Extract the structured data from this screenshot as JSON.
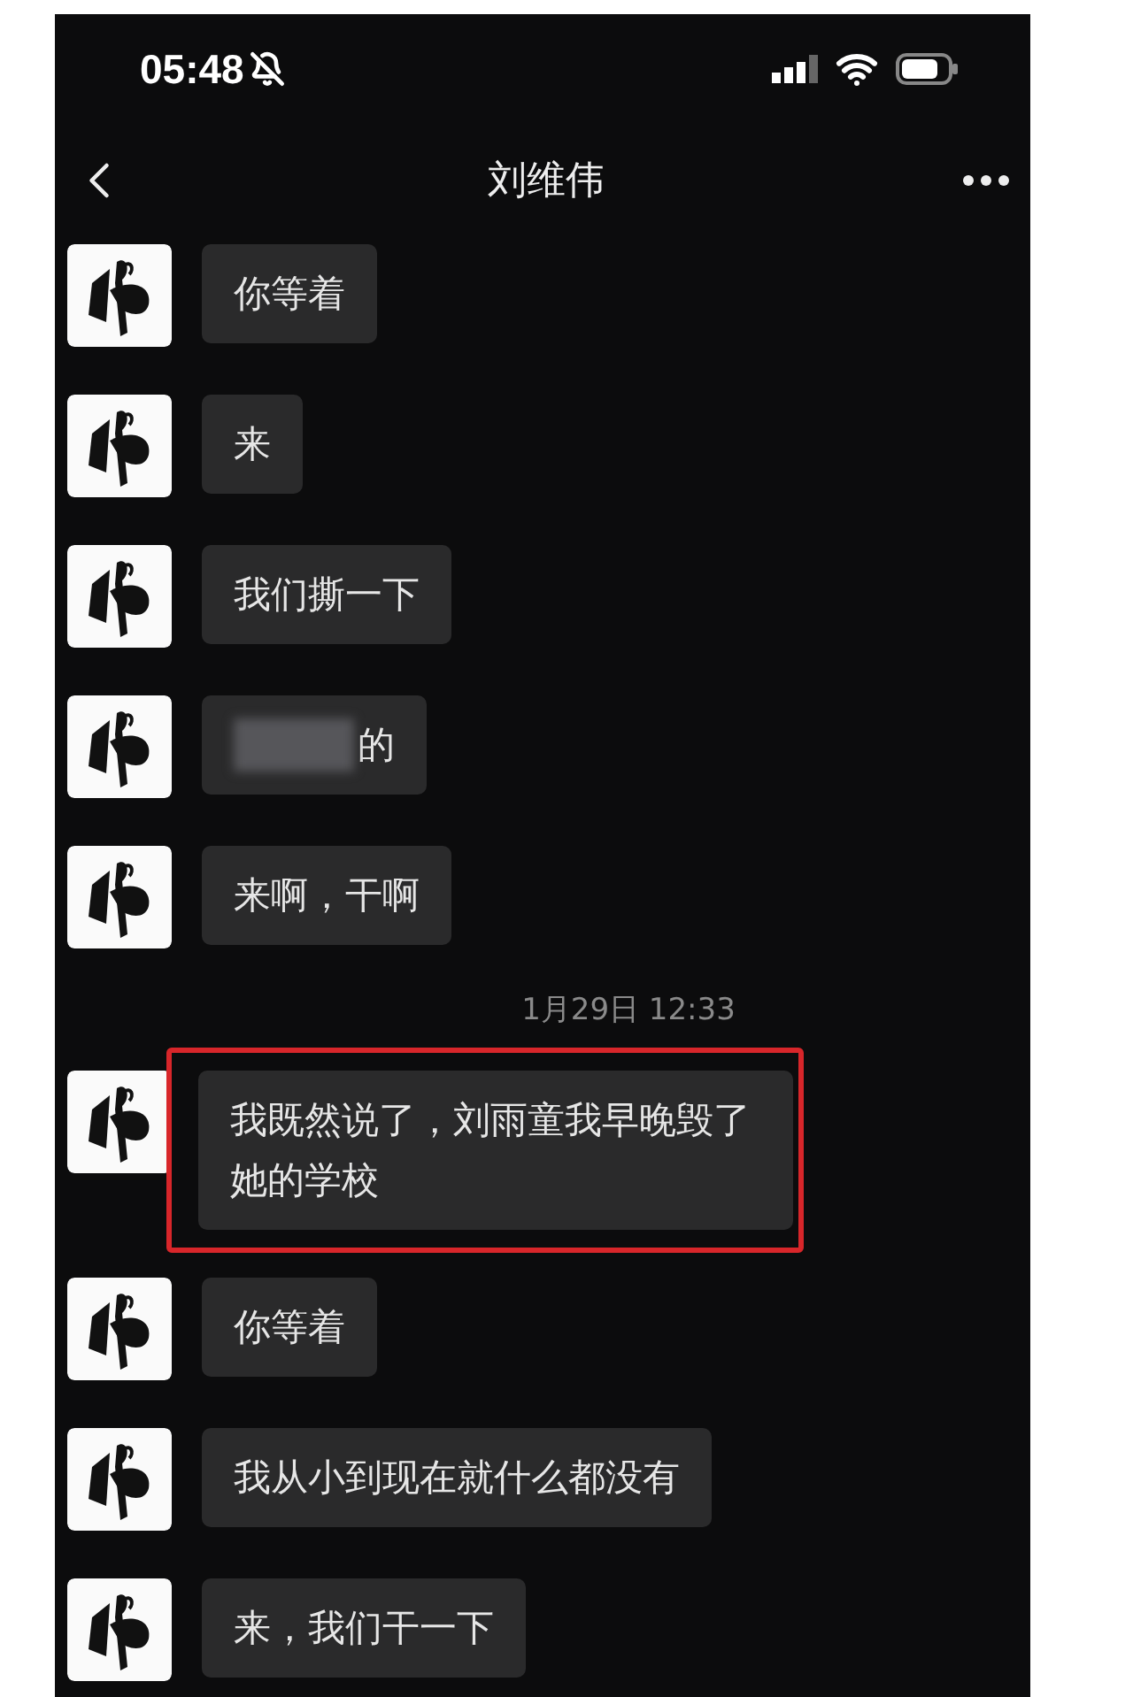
{
  "status_bar": {
    "time": "05:48",
    "silent": true
  },
  "header": {
    "title": "刘维伟"
  },
  "messages": [
    {
      "kind": "text",
      "text": "你等着",
      "redacted": false,
      "highlighted": false
    },
    {
      "kind": "text",
      "text": "来",
      "redacted": false,
      "highlighted": false
    },
    {
      "kind": "text",
      "text": "我们撕一下",
      "redacted": false,
      "highlighted": false
    },
    {
      "kind": "text",
      "text": "的",
      "redacted": true,
      "highlighted": false
    },
    {
      "kind": "text",
      "text": "来啊，干啊",
      "redacted": false,
      "highlighted": false
    },
    {
      "kind": "time",
      "text": "1月29日 12:33"
    },
    {
      "kind": "text",
      "text": "我既然说了，刘雨童我早晚毁了她的学校",
      "redacted": false,
      "highlighted": true
    },
    {
      "kind": "text",
      "text": "你等着",
      "redacted": false,
      "highlighted": false
    },
    {
      "kind": "text",
      "text": "我从小到现在就什么都没有",
      "redacted": false,
      "highlighted": false
    },
    {
      "kind": "text",
      "text": "来，我们干一下",
      "redacted": false,
      "highlighted": false
    }
  ]
}
